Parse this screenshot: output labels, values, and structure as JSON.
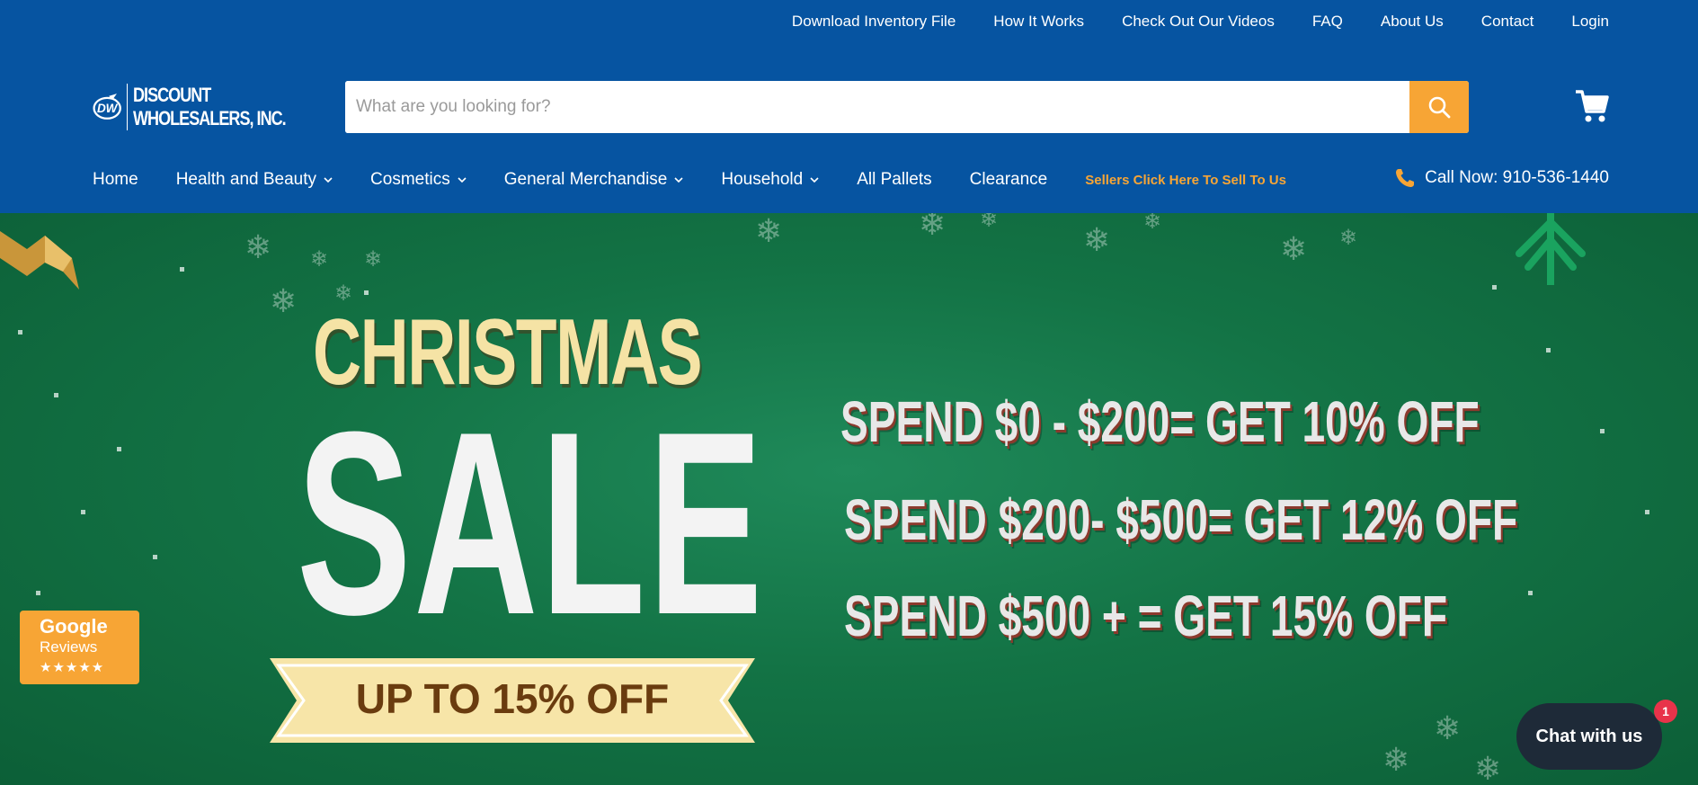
{
  "utility_nav": [
    "Download Inventory File",
    "How It Works",
    "Check Out Our Videos",
    "FAQ",
    "About Us",
    "Contact",
    "Login"
  ],
  "logo": {
    "initials": "DW",
    "line1": "DISCOUNT",
    "line2": "WHOLESALERS, INC."
  },
  "search": {
    "placeholder": "What are you looking for?",
    "icon": "search-icon"
  },
  "cart": {
    "icon": "cart-icon"
  },
  "main_nav": [
    {
      "label": "Home",
      "dropdown": false
    },
    {
      "label": "Health and Beauty",
      "dropdown": true
    },
    {
      "label": "Cosmetics",
      "dropdown": true
    },
    {
      "label": "General Merchandise",
      "dropdown": true
    },
    {
      "label": "Household",
      "dropdown": true
    },
    {
      "label": "All Pallets",
      "dropdown": false
    },
    {
      "label": "Clearance",
      "dropdown": false
    }
  ],
  "sell_link": "Sellers Click Here To Sell To Us",
  "call": {
    "label": "Call Now: 910-536-1440",
    "icon": "phone-icon"
  },
  "banner": {
    "headline": "CHRISTMAS",
    "sale": "SALE",
    "ribbon": "UP TO 15% OFF",
    "offers": [
      "SPEND $0 - $200= GET 10% OFF",
      "SPEND $200- $500= GET 12% OFF",
      "SPEND $500  + = GET 15% OFF"
    ]
  },
  "google_badge": {
    "title": "Google",
    "subtitle": "Reviews",
    "stars": "★★★★★"
  },
  "chat": {
    "label": "Chat with us",
    "badge": "1"
  },
  "colors": {
    "header_bg": "#0654a1",
    "accent": "#f7a535",
    "banner_bg": "#137345",
    "chat_bg": "#1e2a38"
  }
}
